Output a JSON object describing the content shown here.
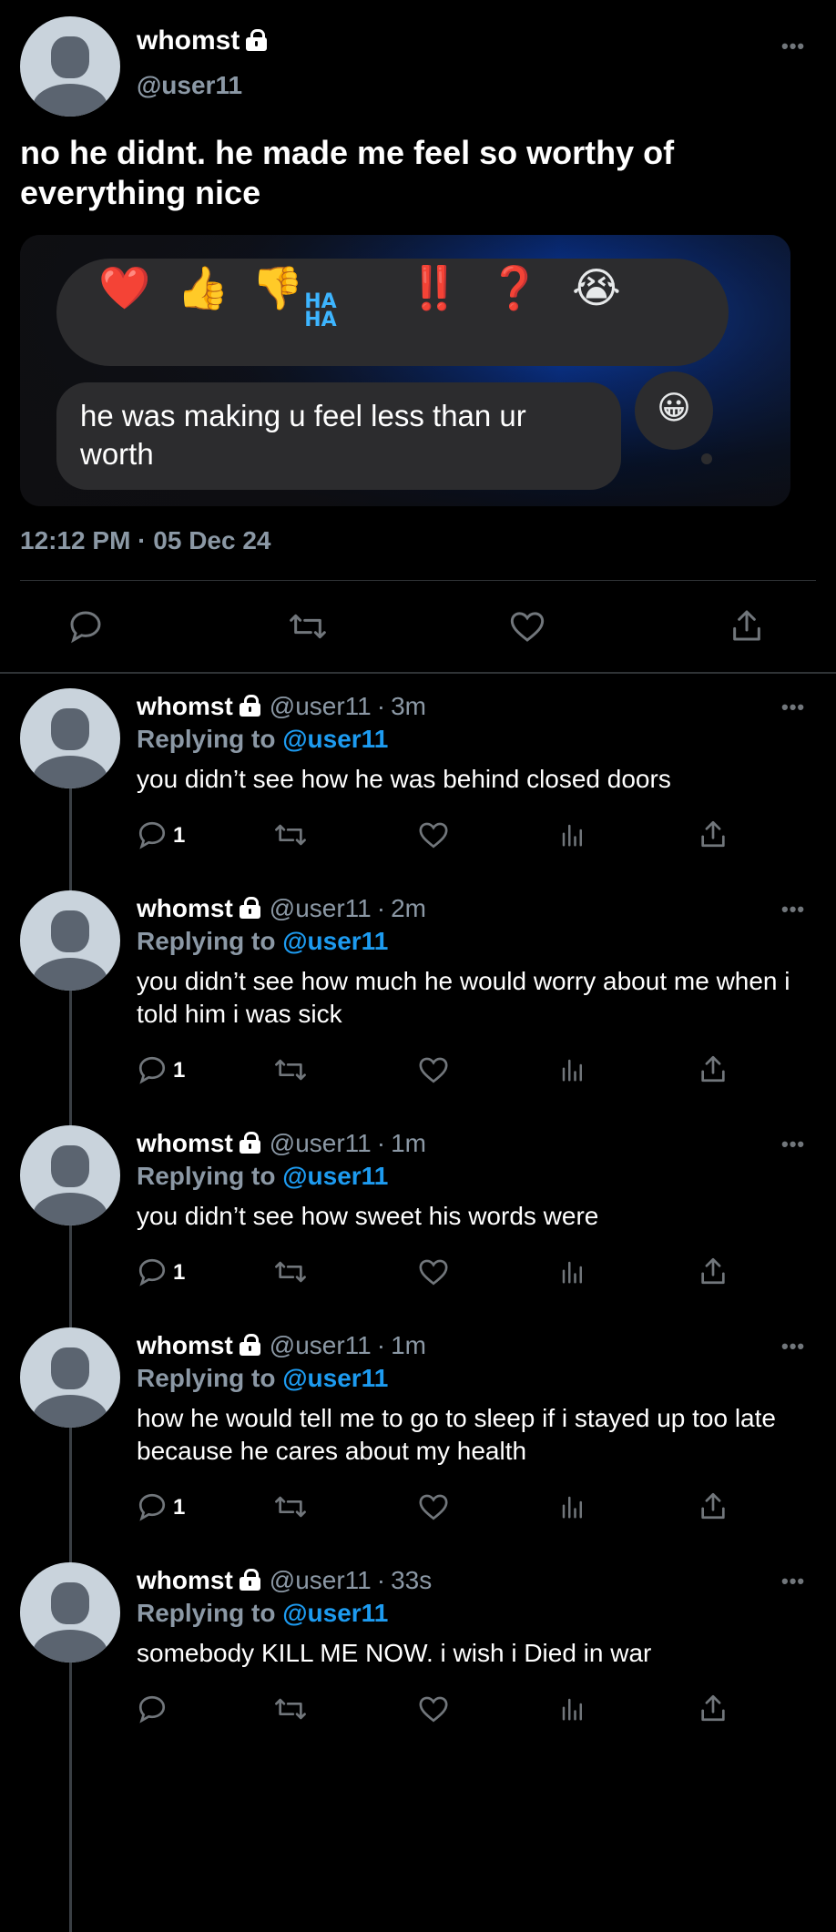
{
  "main_tweet": {
    "author_name": "whomst",
    "author_handle": "@user11",
    "text": "no he didnt. he made me feel so worthy of everything nice",
    "timestamp": "12:12 PM · 05 Dec 24",
    "media": {
      "reactions": [
        "❤️",
        "👍",
        "👎",
        "HA HA",
        "‼️",
        "❓",
        "😭"
      ],
      "haha_top": "HA",
      "haha_bottom": "HA",
      "message_text": "he was making u feel less than ur worth",
      "emoji": "😀"
    }
  },
  "replies": [
    {
      "name": "whomst",
      "handle": "@user11",
      "time": "3m",
      "replying_label": "Replying to",
      "replying_to": "@user11",
      "text": "you didn’t see how he was behind closed doors",
      "reply_count": "1"
    },
    {
      "name": "whomst",
      "handle": "@user11",
      "time": "2m",
      "replying_label": "Replying to",
      "replying_to": "@user11",
      "text": "you didn’t see how much he would worry about me when i told him i was sick",
      "reply_count": "1"
    },
    {
      "name": "whomst",
      "handle": "@user11",
      "time": "1m",
      "replying_label": "Replying to",
      "replying_to": "@user11",
      "text": "you didn’t see how sweet his words were",
      "reply_count": "1"
    },
    {
      "name": "whomst",
      "handle": "@user11",
      "time": "1m",
      "replying_label": "Replying to",
      "replying_to": "@user11",
      "text": "how he would tell me to go to sleep if i stayed up too late because he cares about my health",
      "reply_count": "1"
    },
    {
      "name": "whomst",
      "handle": "@user11",
      "time": "33s",
      "replying_label": "Replying to",
      "replying_to": "@user11",
      "text": "somebody KILL ME NOW. i wish i Died in war",
      "reply_count": ""
    }
  ],
  "icons": {
    "more": "more-dots-icon",
    "reply": "reply-icon",
    "retweet": "retweet-icon",
    "like": "heart-icon",
    "views": "analytics-icon",
    "share": "share-icon",
    "lock": "lock-icon",
    "avatar": "default-avatar"
  },
  "colors": {
    "background": "#000000",
    "text": "#e7e9ea",
    "secondary": "#8b98a5",
    "accent": "#1d9bf0",
    "divider": "#2f3336",
    "bubble": "#2c2c2e"
  }
}
